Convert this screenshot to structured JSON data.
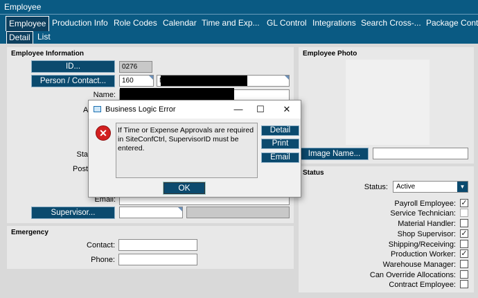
{
  "window": {
    "title": "Employee"
  },
  "tabs": [
    "Employee",
    "Production Info",
    "Role Codes",
    "Calendar",
    "Time and Exp...",
    "GL Control",
    "Integrations",
    "Search  Cross-...",
    "Package Contro"
  ],
  "subtabs": [
    "Detail",
    "List"
  ],
  "employee_info": {
    "title": "Employee Information",
    "id_button": "ID...",
    "id_value": "0276",
    "person_button": "Person / Contact...",
    "person_value": "160",
    "person_name_prefix": "N",
    "name_label": "Name:",
    "partial_label_a": "A",
    "partial_label_sta": "Sta",
    "partial_label_post": "Post",
    "email_label": "Email:",
    "supervisor_button": "Supervisor..."
  },
  "emergency": {
    "title": "Emergency",
    "contact_label": "Contact:",
    "phone_label": "Phone:"
  },
  "photo": {
    "title": "Employee Photo",
    "image_name_button": "Image Name..."
  },
  "status": {
    "title": "Status",
    "status_label": "Status:",
    "status_value": "Active",
    "flags": [
      {
        "label": "Payroll Employee:",
        "checked": true
      },
      {
        "label": "Service Technician:",
        "checked": false
      },
      {
        "label": "Material Handler:",
        "checked": false
      },
      {
        "label": "Shop Supervisor:",
        "checked": true
      },
      {
        "label": "Shipping/Receiving:",
        "checked": false
      },
      {
        "label": "Production Worker:",
        "checked": true
      },
      {
        "label": "Warehouse Manager:",
        "checked": false
      },
      {
        "label": "Can Override Allocations:",
        "checked": false
      },
      {
        "label": "Contract Employee:",
        "checked": false
      }
    ]
  },
  "dialog": {
    "title": "Business Logic Error",
    "message": "If Time or Expense Approvals are required in SiteConfCtrl, SupervisorID must be entered.",
    "buttons": [
      "Detail",
      "Print",
      "Email"
    ],
    "ok": "OK",
    "minimize": "—",
    "maximize": "☐",
    "close": "✕"
  },
  "colors": {
    "accent": "#0a5a83",
    "button": "#0b4a6e",
    "error": "#d21f1f"
  }
}
